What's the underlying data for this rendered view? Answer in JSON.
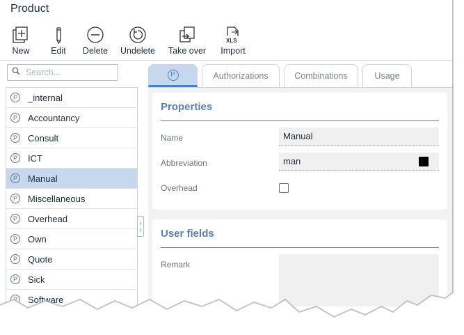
{
  "app": {
    "title": "Product"
  },
  "toolbar": {
    "buttons": [
      {
        "icon": "new-icon",
        "label": "New"
      },
      {
        "icon": "edit-icon",
        "label": "Edit"
      },
      {
        "icon": "delete-icon",
        "label": "Delete"
      },
      {
        "icon": "undelete-icon",
        "label": "Undelete"
      },
      {
        "icon": "take-over-icon",
        "label": "Take over"
      },
      {
        "icon": "import-xls-icon",
        "label": "Import"
      }
    ]
  },
  "search": {
    "placeholder": "Search..."
  },
  "list": {
    "selected": "Manual",
    "items": [
      "_internal",
      "Accountancy",
      "Consult",
      "ICT",
      "Manual",
      "Miscellaneous",
      "Overhead",
      "Own",
      "Quote",
      "Sick",
      "Software"
    ]
  },
  "tabs": [
    {
      "label": "P",
      "active": true
    },
    {
      "label": "Authorizations",
      "active": false
    },
    {
      "label": "Combinations",
      "active": false
    },
    {
      "label": "Usage",
      "active": false
    }
  ],
  "properties": {
    "heading": "Properties",
    "name_label": "Name",
    "name_value": "Manual",
    "abbreviation_label": "Abbreviation",
    "abbreviation_value": "man",
    "abbreviation_color": "#000000",
    "overhead_label": "Overhead",
    "overhead_checked": false
  },
  "user_fields": {
    "heading": "User fields",
    "remark_label": "Remark",
    "remark_value": ""
  },
  "colors": {
    "accent": "#4a80c8",
    "selection": "#c7d7ee",
    "heading": "#5a7fb0"
  }
}
